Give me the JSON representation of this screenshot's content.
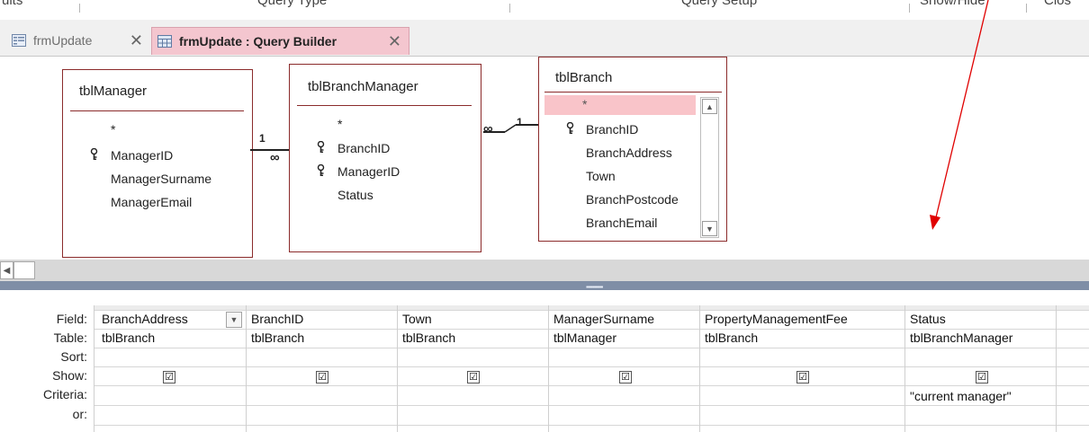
{
  "ribbon": {
    "groups": [
      "ults",
      "Query Type",
      "Query Setup",
      "Show/Hide",
      "Clos"
    ]
  },
  "tabs": {
    "inactive_label": "frmUpdate",
    "active_label": "frmUpdate : Query Builder",
    "close_glyph": "✕"
  },
  "tables": {
    "manager": {
      "title": "tblManager",
      "fields": [
        "*",
        "ManagerID",
        "ManagerSurname",
        "ManagerEmail"
      ]
    },
    "branch_manager": {
      "title": "tblBranchManager",
      "fields": [
        "*",
        "BranchID",
        "ManagerID",
        "Status"
      ]
    },
    "branch": {
      "title": "tblBranch",
      "fields": [
        "*",
        "BranchID",
        "BranchAddress",
        "Town",
        "BranchPostcode",
        "BranchEmail"
      ]
    }
  },
  "relationships": {
    "one": "1",
    "many": "∞"
  },
  "grid": {
    "row_labels": [
      "Field:",
      "Table:",
      "Sort:",
      "Show:",
      "Criteria:",
      "or:"
    ],
    "columns": [
      {
        "field": "BranchAddress",
        "table": "tblBranch",
        "show": "☑",
        "criteria": ""
      },
      {
        "field": "BranchID",
        "table": "tblBranch",
        "show": "☑",
        "criteria": ""
      },
      {
        "field": "Town",
        "table": "tblBranch",
        "show": "☑",
        "criteria": ""
      },
      {
        "field": "ManagerSurname",
        "table": "tblManager",
        "show": "☑",
        "criteria": ""
      },
      {
        "field": "PropertyManagementFee",
        "table": "tblBranch",
        "show": "☑",
        "criteria": ""
      },
      {
        "field": "Status",
        "table": "tblBranchManager",
        "show": "☑",
        "criteria": "\"current manager\""
      }
    ]
  },
  "colors": {
    "accent_tab": "#f4c6cf",
    "table_border": "#8b2b2b",
    "selected_row": "#f9c4c9",
    "annotation_arrow": "#e00000",
    "splitter": "#7f8ea6"
  }
}
